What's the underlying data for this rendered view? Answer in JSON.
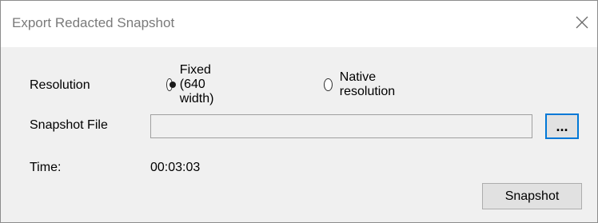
{
  "window": {
    "title": "Export Redacted Snapshot"
  },
  "resolution": {
    "label": "Resolution",
    "options": [
      {
        "label": "Fixed (640 width)",
        "selected": true
      },
      {
        "label": "Native resolution",
        "selected": false
      }
    ]
  },
  "snapshot_file": {
    "label": "Snapshot File",
    "value": "",
    "browse_label": "..."
  },
  "time": {
    "label": "Time:",
    "value": "00:03:03"
  },
  "actions": {
    "snapshot_label": "Snapshot"
  },
  "icons": {
    "close": "close-icon"
  }
}
